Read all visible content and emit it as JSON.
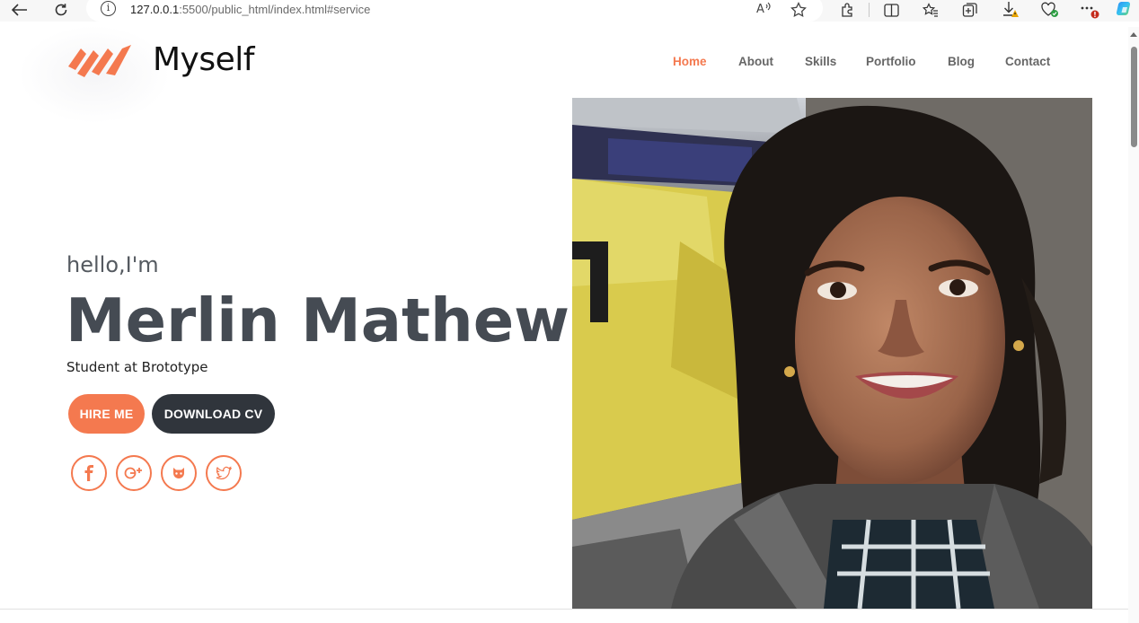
{
  "browser": {
    "url_host": "127.0.0.1",
    "url_path": ":5500/public_html/index.html#service",
    "download_badge": "!"
  },
  "site": {
    "logo_text": "Myself",
    "brand_color": "#f4794f",
    "dark_color": "#30353c",
    "nav": [
      "Home",
      "About",
      "Skills",
      "Portfolio",
      "Blog",
      "Contact"
    ],
    "active_nav": "Home"
  },
  "hero": {
    "greeting": "hello,I'm",
    "name": "Merlin Mathew",
    "tagline": "Student at Brototype",
    "hire_button": "HIRE ME",
    "cv_button": "DOWNLOAD CV",
    "social_icons": [
      "facebook-icon",
      "google-plus-icon",
      "github-icon",
      "twitter-icon"
    ],
    "social_glyphs": [
      "f",
      "g+",
      "⊙",
      "❒"
    ]
  }
}
